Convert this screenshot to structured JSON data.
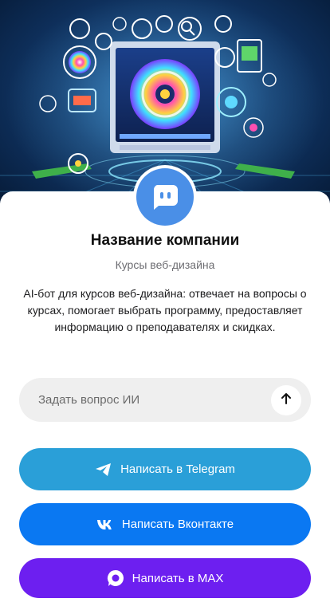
{
  "company": {
    "name": "Название компании",
    "subtitle": "Курсы веб-дизайна",
    "description": "AI-бот для курсов веб-дизайна: отвечает на вопросы о курсах, помогает выбрать программу, предоставляет информацию о преподавателях и скидках."
  },
  "ask": {
    "placeholder": "Задать вопрос ИИ"
  },
  "buttons": {
    "telegram": "Написать в Telegram",
    "vk": "Написать Вконтакте",
    "max": "Написать в MAX"
  },
  "colors": {
    "avatar": "#4a8fe7",
    "telegram": "#2a9fd8",
    "vk": "#0a78f2",
    "max": "#6d1ff0",
    "input_bg": "#efefef"
  },
  "icons": {
    "avatar": "chat-bot-icon",
    "send": "arrow-up-icon",
    "telegram": "telegram-icon",
    "vk": "vk-icon",
    "max": "max-icon"
  }
}
